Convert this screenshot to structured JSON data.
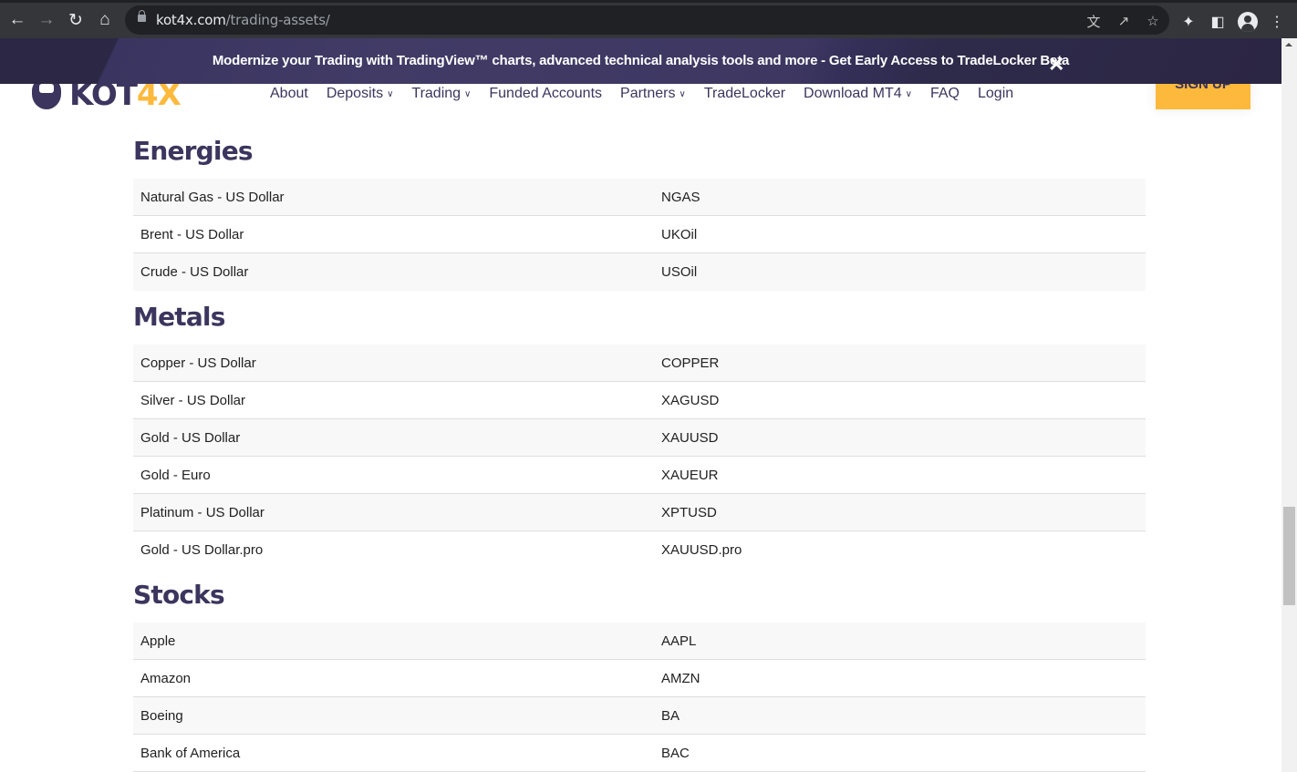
{
  "browser": {
    "url_host": "kot4x.com",
    "url_path": "/trading-assets/",
    "icons": {
      "back": "back-arrow-icon",
      "forward": "forward-arrow-icon",
      "reload": "reload-icon",
      "home": "home-icon",
      "lock": "lock-icon",
      "translate": "translate-icon",
      "share": "share-icon",
      "bookmark": "star-icon",
      "extensions": "puzzle-icon",
      "sidepanel": "side-panel-icon",
      "profile": "profile-avatar-icon",
      "menu": "kebab-menu-icon"
    }
  },
  "banner": {
    "text": "Modernize your Trading with TradingView™ charts, advanced technical analysis tools and more - Get Early Access to TradeLocker Beta",
    "close_glyph": "✕"
  },
  "header": {
    "logo_left": "KOT",
    "logo_right": "4X",
    "nav": [
      {
        "label": "About",
        "dropdown": false
      },
      {
        "label": "Deposits",
        "dropdown": true
      },
      {
        "label": "Trading",
        "dropdown": true
      },
      {
        "label": "Funded Accounts",
        "dropdown": false
      },
      {
        "label": "Partners",
        "dropdown": true
      },
      {
        "label": "TradeLocker",
        "dropdown": false
      },
      {
        "label": "Download MT4",
        "dropdown": true
      },
      {
        "label": "FAQ",
        "dropdown": false
      },
      {
        "label": "Login",
        "dropdown": false
      }
    ],
    "chevron_glyph": "⌄",
    "signup_label": "SIGN UP"
  },
  "colors": {
    "brand_navy": "#3c355e",
    "brand_yellow": "#fdb93c",
    "banner_bg": "#3d3762",
    "row_alt": "#f8f8f8",
    "row_border": "#dedede"
  },
  "sections": [
    {
      "title": "Energies",
      "rows": [
        {
          "name": "Natural Gas - US Dollar",
          "symbol": "NGAS"
        },
        {
          "name": "Brent - US Dollar",
          "symbol": "UKOil"
        },
        {
          "name": "Crude - US Dollar",
          "symbol": "USOil"
        }
      ]
    },
    {
      "title": "Metals",
      "rows": [
        {
          "name": "Copper - US Dollar",
          "symbol": "COPPER"
        },
        {
          "name": "Silver - US Dollar",
          "symbol": "XAGUSD"
        },
        {
          "name": "Gold - US Dollar",
          "symbol": "XAUUSD"
        },
        {
          "name": "Gold - Euro",
          "symbol": "XAUEUR"
        },
        {
          "name": "Platinum - US Dollar",
          "symbol": "XPTUSD"
        },
        {
          "name": "Gold - US Dollar.pro",
          "symbol": "XAUUSD.pro"
        }
      ]
    },
    {
      "title": "Stocks",
      "rows": [
        {
          "name": "Apple",
          "symbol": "AAPL"
        },
        {
          "name": "Amazon",
          "symbol": "AMZN"
        },
        {
          "name": "Boeing",
          "symbol": "BA"
        },
        {
          "name": "Bank of America",
          "symbol": "BAC"
        }
      ]
    }
  ]
}
